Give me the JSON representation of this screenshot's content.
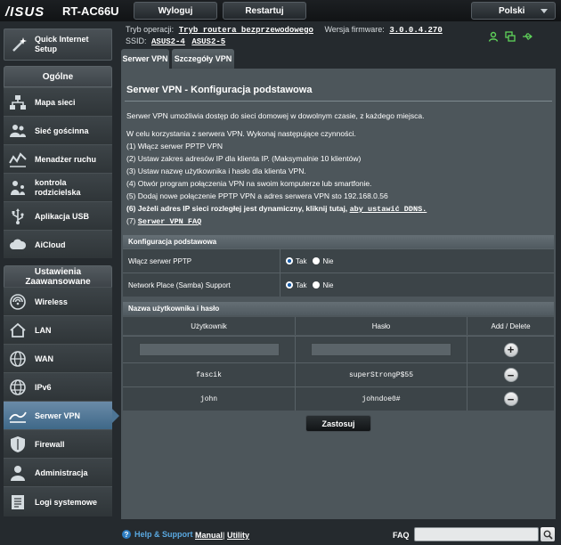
{
  "brand": {
    "logo": "/ISUS",
    "model": "RT-AC66U"
  },
  "topbar": {
    "logout": "Wyloguj",
    "restart": "Restartuj",
    "language": "Polski"
  },
  "info": {
    "mode_label": "Tryb operacji:",
    "mode_value": "Tryb routera bezprzewodowego",
    "fw_label": "Wersja firmware:",
    "fw_value": "3.0.0.4.270",
    "ssid_label": "SSID:",
    "ssid_1": "ASUS2-4",
    "ssid_2": "ASUS2-5"
  },
  "sidebar": {
    "quick": "Quick Internet Setup",
    "general_head": "Ogólne",
    "general": [
      {
        "label": "Mapa sieci",
        "icon": "network-map-icon"
      },
      {
        "label": "Sieć gościnna",
        "icon": "guest-network-icon"
      },
      {
        "label": "Menadżer ruchu",
        "icon": "traffic-manager-icon"
      },
      {
        "label": "kontrola rodzicielska",
        "icon": "parental-control-icon"
      },
      {
        "label": "Aplikacja USB",
        "icon": "usb-app-icon"
      },
      {
        "label": "AiCloud",
        "icon": "aicloud-icon"
      }
    ],
    "advanced_head": "Ustawienia Zaawansowane",
    "advanced": [
      {
        "label": "Wireless",
        "icon": "wireless-icon"
      },
      {
        "label": "LAN",
        "icon": "lan-icon"
      },
      {
        "label": "WAN",
        "icon": "wan-icon"
      },
      {
        "label": "IPv6",
        "icon": "ipv6-icon"
      },
      {
        "label": "Serwer VPN",
        "icon": "vpn-icon",
        "active": true
      },
      {
        "label": "Firewall",
        "icon": "firewall-icon"
      },
      {
        "label": "Administracja",
        "icon": "admin-icon"
      },
      {
        "label": "Logi systemowe",
        "icon": "syslog-icon"
      }
    ]
  },
  "tabs": {
    "active": "Serwer VPN",
    "other": "Szczegóły VPN"
  },
  "main": {
    "title": "Serwer VPN - Konfiguracja podstawowa",
    "intro": "Serwer VPN umożliwia dostęp do sieci domowej w dowolnym czasie, z każdego miejsca.",
    "steps_intro": "W celu korzystania z serwera VPN. Wykonaj następujące czynności.",
    "steps": [
      "(1) Włącz serwer PPTP VPN",
      "(2) Ustaw zakres adresów IP dla klienta IP. (Maksymalnie 10 klientów)",
      "(3) Ustaw nazwę użytkownika i hasło dla klienta VPN.",
      "(4) Otwór program połączenia VPN na swoim komputerze lub smartfonie.",
      "(5) Dodaj nowe połączenie PPTP VPN a adres serwera VPN sto 192.168.0.56"
    ],
    "step6_text": "(6) Jeżeli adres IP sieci rozległej jest dynamiczny, kliknij tutaj,",
    "step6_link": "aby ustawić DDNS.",
    "step7_num": "(7)",
    "step7_link": "Serwer VPN FAQ"
  },
  "basic": {
    "head": "Konfiguracja podstawowa",
    "rows": [
      {
        "label": "Włącz serwer PPTP",
        "yes": "Tak",
        "no": "Nie",
        "selected": "Tak"
      },
      {
        "label": "Network Place (Samba) Support",
        "yes": "Tak",
        "no": "Nie",
        "selected": "Tak"
      }
    ]
  },
  "users": {
    "head": "Nazwa użytkownika i hasło",
    "col_user": "Użytkownik",
    "col_pass": "Hasło",
    "col_action": "Add / Delete",
    "new_user": "",
    "new_pass": "",
    "add_symbol": "+",
    "delete_symbol": "−",
    "rows": [
      {
        "user": "fascik",
        "pass": "superStrongP$55"
      },
      {
        "user": "john",
        "pass": "johndoe0#"
      }
    ]
  },
  "apply": "Zastosuj",
  "footer": {
    "help": "Help & Support",
    "manual": "Manual",
    "sep": "|",
    "utility": "Utility",
    "faq": "FAQ",
    "faq_query": ""
  },
  "colors": {
    "accent": "#5aa8e0",
    "active_nav": "#4d7595",
    "status_green": "#5fd35a"
  }
}
